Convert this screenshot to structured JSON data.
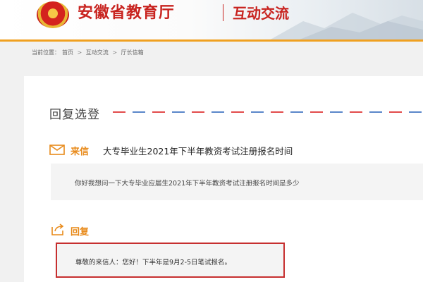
{
  "header": {
    "site_title": "安徽省教育厅",
    "section_title": "互动交流"
  },
  "breadcrumb": {
    "label": "当前位置：",
    "items": [
      "首页",
      "互动交流",
      "厅长信箱"
    ],
    "separator": ">"
  },
  "main": {
    "heading": "回复选登",
    "letter": {
      "label": "来信",
      "title": "大专毕业生2021年下半年教资考试注册报名时间",
      "body": "你好我想问一下大专毕业应届生2021年下半年教资考试注册报名时间是多少"
    },
    "reply": {
      "label": "回复",
      "body": "尊敬的来信人：您好！下半年是9月2-5日笔试报名。"
    }
  },
  "colors": {
    "brand_red": "#c8231f",
    "accent_orange": "#e88a1a",
    "header_line": "#f0a020",
    "highlight_border": "#c62f2f"
  },
  "icons": {
    "letter": "envelope-icon",
    "reply": "reply-share-icon",
    "emblem": "national-emblem"
  }
}
